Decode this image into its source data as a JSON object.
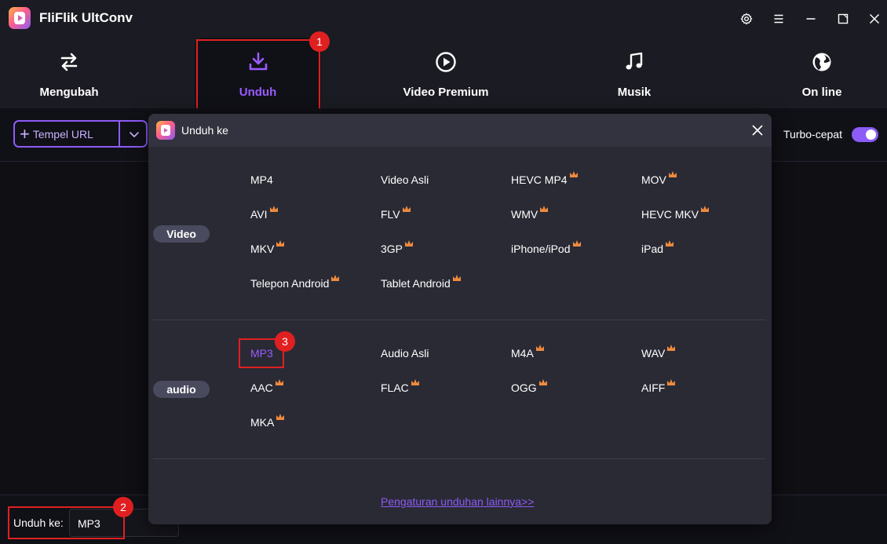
{
  "app": {
    "title": "FliFlik UltConv"
  },
  "nav": {
    "tabs": [
      {
        "label": "Mengubah",
        "icon": "convert-arrows-icon"
      },
      {
        "label": "Unduh",
        "icon": "download-icon",
        "active": true
      },
      {
        "label": "Video Premium",
        "icon": "play-circle-icon"
      },
      {
        "label": "Musik",
        "icon": "music-note-icon"
      },
      {
        "label": "On line",
        "icon": "globe-icon"
      }
    ]
  },
  "toolbar": {
    "paste_label": "Tempel URL",
    "turbo_label": "Turbo-cepat",
    "turbo_on": true
  },
  "annotations": {
    "one": "1",
    "two": "2",
    "three": "3"
  },
  "bottom": {
    "download_to_label": "Unduh ke:",
    "download_to_value": "MP3"
  },
  "modal": {
    "title": "Unduh ke",
    "video_section": "Video",
    "audio_section": "audio",
    "video_formats": [
      {
        "label": "MP4",
        "premium": false
      },
      {
        "label": "Video Asli",
        "premium": false
      },
      {
        "label": "HEVC MP4",
        "premium": true
      },
      {
        "label": "MOV",
        "premium": true
      },
      {
        "label": "AVI",
        "premium": true
      },
      {
        "label": "FLV",
        "premium": true
      },
      {
        "label": "WMV",
        "premium": true
      },
      {
        "label": "HEVC MKV",
        "premium": true
      },
      {
        "label": "MKV",
        "premium": true
      },
      {
        "label": "3GP",
        "premium": true
      },
      {
        "label": "iPhone/iPod",
        "premium": true
      },
      {
        "label": "iPad",
        "premium": true
      },
      {
        "label": "Telepon Android",
        "premium": true
      },
      {
        "label": "Tablet Android",
        "premium": true
      }
    ],
    "audio_formats": [
      {
        "label": "MP3",
        "premium": false,
        "selected": true
      },
      {
        "label": "Audio Asli",
        "premium": false
      },
      {
        "label": "M4A",
        "premium": true
      },
      {
        "label": "WAV",
        "premium": true
      },
      {
        "label": "AAC",
        "premium": true
      },
      {
        "label": "FLAC",
        "premium": true
      },
      {
        "label": "OGG",
        "premium": true
      },
      {
        "label": "AIFF",
        "premium": true
      },
      {
        "label": "MKA",
        "premium": true
      }
    ],
    "more_settings_link": "Pengaturan unduhan lainnya>>"
  },
  "colors": {
    "accent": "#8b5cf6",
    "annotation": "#e02020",
    "premium_crown": "#f08a3c"
  }
}
